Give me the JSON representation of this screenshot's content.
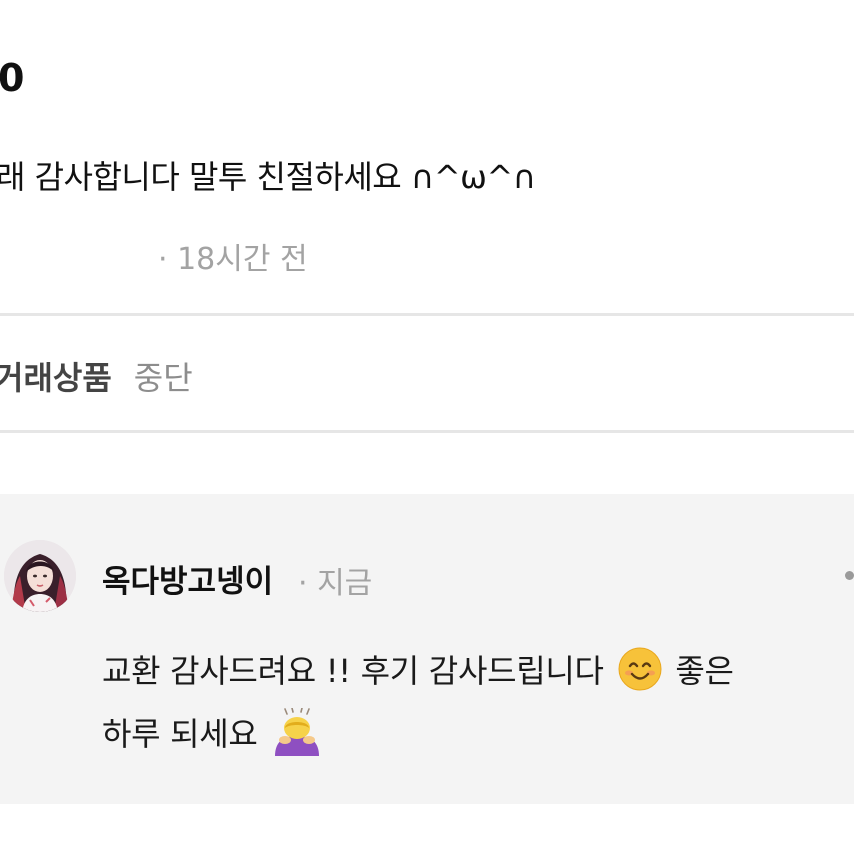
{
  "review": {
    "rating_fragment": "0",
    "text": "래 감사합니다 말투 친절하세요 ∩^ω^∩",
    "time": "· 18시간 전"
  },
  "trade": {
    "label": "거래상품",
    "value": "중단"
  },
  "reply": {
    "author": "옥다방고넹이",
    "time": "· 지금",
    "line1": "교환 감사드려요 !! 후기 감사드립니다",
    "line1_tail": "좋은",
    "line2": "하루 되세요",
    "emojis": [
      "smiling-face-emoji",
      "person-bowing-emoji"
    ]
  },
  "colors": {
    "divider": "#e6e6e6",
    "reply_background": "#f4f4f4",
    "muted_text": "#a3a3a3",
    "emoji_yellow": "#f7c23a",
    "emoji_purple": "#8e4fc1"
  }
}
